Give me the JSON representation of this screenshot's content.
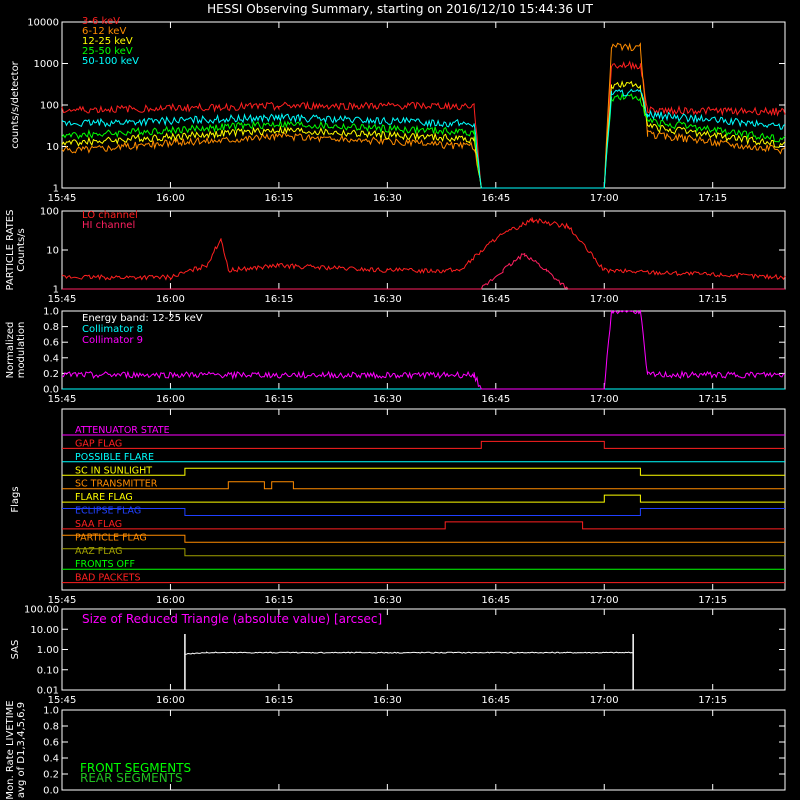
{
  "title": "HESSI Observing Summary, starting on 2016/12/10 15:44:36 UT",
  "time_ticks": [
    "15:45",
    "16:00",
    "16:15",
    "16:30",
    "16:45",
    "17:00",
    "17:15"
  ],
  "colors": {
    "red": "#ff2020",
    "orange": "#ff8c00",
    "yellow": "#ffff00",
    "green": "#00ff00",
    "cyan": "#00ffff",
    "magenta": "#ff00ff",
    "crimson": "#ff2060",
    "blue": "#2040ff",
    "olive": "#a0a000",
    "darkgreen": "#20c020"
  },
  "chart_data": [
    {
      "type": "line",
      "panel": "count rates",
      "ylabel": "counts/s/detector",
      "yscale": "log",
      "ylim": [
        1,
        10000
      ],
      "yticks": [
        "1",
        "10",
        "100",
        "1000",
        "10000"
      ],
      "legend_placement": "top-left",
      "series": [
        {
          "name": "3-6 keV",
          "color_key": "red",
          "x": [
            "15:45",
            "16:15",
            "16:42",
            "16:43",
            "17:00",
            "17:01",
            "17:05",
            "17:06",
            "17:25"
          ],
          "values": [
            75,
            95,
            95,
            1,
            1,
            900,
            900,
            75,
            70
          ]
        },
        {
          "name": "6-12 keV",
          "color_key": "orange",
          "x": [
            "15:45",
            "16:15",
            "16:42",
            "16:43",
            "17:00",
            "17:01",
            "17:05",
            "17:06",
            "17:25"
          ],
          "values": [
            8,
            18,
            10,
            1,
            1,
            2500,
            2500,
            20,
            8
          ]
        },
        {
          "name": "12-25 keV",
          "color_key": "yellow",
          "x": [
            "15:45",
            "16:15",
            "16:42",
            "16:43",
            "17:00",
            "17:01",
            "17:05",
            "17:06",
            "17:25"
          ],
          "values": [
            12,
            25,
            15,
            1,
            1,
            300,
            300,
            30,
            11
          ]
        },
        {
          "name": "25-50 keV",
          "color_key": "green",
          "x": [
            "15:45",
            "16:15",
            "16:42",
            "16:43",
            "17:00",
            "17:01",
            "17:05",
            "17:06",
            "17:25"
          ],
          "values": [
            18,
            35,
            22,
            1,
            1,
            150,
            150,
            40,
            15
          ]
        },
        {
          "name": "50-100 keV",
          "color_key": "cyan",
          "x": [
            "15:45",
            "16:15",
            "16:42",
            "16:43",
            "17:00",
            "17:01",
            "17:05",
            "17:06",
            "17:25"
          ],
          "values": [
            35,
            50,
            35,
            1,
            1,
            200,
            200,
            60,
            30
          ]
        }
      ]
    },
    {
      "type": "line",
      "panel": "particle rates",
      "ylabel": "PARTICLE RATES\nCounts/s",
      "yscale": "log",
      "ylim": [
        1,
        100
      ],
      "yticks": [
        "1",
        "10",
        "100"
      ],
      "legend_placement": "top-left",
      "series": [
        {
          "name": "LO channel",
          "color_key": "red",
          "x": [
            "15:45",
            "16:00",
            "16:05",
            "16:07",
            "16:08",
            "16:15",
            "16:30",
            "16:40",
            "16:45",
            "16:50",
            "16:55",
            "17:00",
            "17:25"
          ],
          "values": [
            2,
            2,
            4,
            20,
            3,
            4,
            3,
            3,
            20,
            60,
            40,
            3,
            2
          ]
        },
        {
          "name": "HI channel",
          "color_key": "crimson",
          "x": [
            "15:45",
            "16:43",
            "16:46",
            "16:49",
            "16:52",
            "16:55",
            "17:25"
          ],
          "values": [
            1,
            1,
            3,
            8,
            3,
            1,
            1
          ]
        }
      ]
    },
    {
      "type": "line",
      "panel": "normalized modulation",
      "ylabel": "Normalized\nmodulation",
      "ylim": [
        0,
        1
      ],
      "yticks": [
        "0.0",
        "0.2",
        "0.4",
        "0.6",
        "0.8",
        "1.0"
      ],
      "annotation": "Energy band: 12-25 keV",
      "series": [
        {
          "name": "Collimator 8",
          "color_key": "cyan",
          "x": [
            "15:45",
            "16:42",
            "16:43",
            "17:25"
          ],
          "values": [
            0.0,
            0.0,
            0.0,
            0.0
          ]
        },
        {
          "name": "Collimator 9",
          "color_key": "magenta",
          "x": [
            "15:45",
            "16:42",
            "16:43",
            "17:00",
            "17:01",
            "17:05",
            "17:06",
            "17:25"
          ],
          "values": [
            0.18,
            0.18,
            0.0,
            0.0,
            1.0,
            1.0,
            0.18,
            0.18
          ]
        }
      ]
    },
    {
      "type": "line",
      "panel": "flags",
      "ylabel": "Flags",
      "series": [
        {
          "name": "ATTENUATOR STATE",
          "color_key": "magenta",
          "segments": [
            [
              "15:45",
              "17:25",
              0
            ]
          ]
        },
        {
          "name": "GAP FLAG",
          "color_key": "red",
          "segments": [
            [
              "15:45",
              "16:43",
              0
            ],
            [
              "16:43",
              "17:00",
              1
            ],
            [
              "17:00",
              "17:25",
              0
            ]
          ]
        },
        {
          "name": "POSSIBLE FLARE",
          "color_key": "cyan",
          "segments": [
            [
              "15:45",
              "17:25",
              0
            ]
          ]
        },
        {
          "name": "SC IN SUNLIGHT",
          "color_key": "yellow",
          "segments": [
            [
              "15:45",
              "16:02",
              0
            ],
            [
              "16:02",
              "17:05",
              1
            ],
            [
              "17:05",
              "17:25",
              0
            ]
          ]
        },
        {
          "name": "SC TRANSMITTER",
          "color_key": "orange",
          "segments": [
            [
              "15:45",
              "16:08",
              0
            ],
            [
              "16:08",
              "16:13",
              1
            ],
            [
              "16:13",
              "16:14",
              0
            ],
            [
              "16:14",
              "16:17",
              1
            ],
            [
              "16:17",
              "17:25",
              0
            ]
          ]
        },
        {
          "name": "FLARE FLAG",
          "color_key": "yellow",
          "segments": [
            [
              "15:45",
              "17:00",
              0
            ],
            [
              "17:00",
              "17:05",
              1
            ],
            [
              "17:05",
              "17:25",
              0
            ]
          ]
        },
        {
          "name": "ECLIPSE FLAG",
          "color_key": "blue",
          "segments": [
            [
              "15:45",
              "16:02",
              1
            ],
            [
              "16:02",
              "17:05",
              0
            ],
            [
              "17:05",
              "17:25",
              1
            ]
          ]
        },
        {
          "name": "SAA FLAG",
          "color_key": "red",
          "segments": [
            [
              "15:45",
              "16:38",
              0
            ],
            [
              "16:38",
              "16:57",
              1
            ],
            [
              "16:57",
              "17:25",
              0
            ]
          ]
        },
        {
          "name": "PARTICLE FLAG",
          "color_key": "orange",
          "segments": [
            [
              "15:45",
              "16:02",
              1
            ],
            [
              "16:02",
              "17:25",
              0
            ]
          ]
        },
        {
          "name": "AAZ FLAG",
          "color_key": "olive",
          "segments": [
            [
              "15:45",
              "16:02",
              1
            ],
            [
              "16:02",
              "17:25",
              0
            ]
          ]
        },
        {
          "name": "FRONTS OFF",
          "color_key": "green",
          "segments": [
            [
              "15:45",
              "17:25",
              0
            ]
          ]
        },
        {
          "name": "BAD PACKETS",
          "color_key": "red",
          "segments": [
            [
              "15:45",
              "17:25",
              0
            ]
          ]
        }
      ]
    },
    {
      "type": "line",
      "panel": "SAS",
      "ylabel": "SAS",
      "yscale": "log",
      "ylim": [
        0.01,
        100
      ],
      "yticks": [
        "0.01",
        "0.10",
        "1.00",
        "10.00",
        "100.00"
      ],
      "annotation": "Size of Reduced Triangle (absolute value) [arcsec]",
      "series": [
        {
          "name": "Size of Reduced Triangle (absolute value) [arcsec]",
          "color_key": "magenta",
          "x": [
            "16:02",
            "16:05",
            "16:30",
            "17:04"
          ],
          "values": [
            0.6,
            0.7,
            0.7,
            0.7
          ]
        }
      ]
    },
    {
      "type": "line",
      "panel": "monitor rate livetime",
      "ylabel": "Mon. Rate LIVETIME\navg of D1,3,4,5,6,9",
      "ylim": [
        0,
        1
      ],
      "yticks": [
        "0.0",
        "0.2",
        "0.4",
        "0.6",
        "0.8",
        "1.0"
      ],
      "series": [
        {
          "name": "FRONT SEGMENTS",
          "color_key": "green"
        },
        {
          "name": "REAR SEGMENTS",
          "color_key": "darkgreen"
        }
      ]
    }
  ]
}
